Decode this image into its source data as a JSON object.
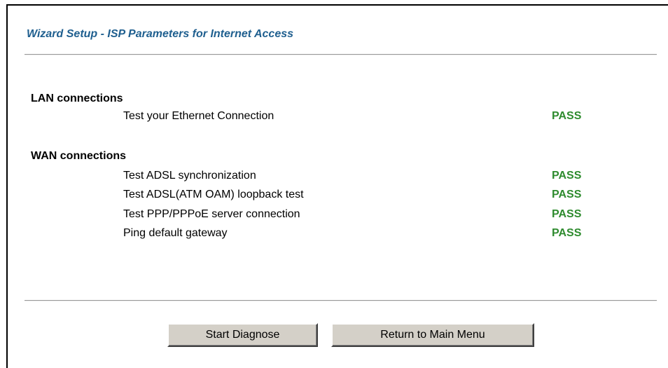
{
  "window": {
    "title": "Wizard Setup - ISP Parameters for Internet Access"
  },
  "sections": {
    "lan": {
      "heading": "LAN connections",
      "tests": [
        {
          "label": "Test your Ethernet Connection",
          "result": "PASS"
        }
      ]
    },
    "wan": {
      "heading": "WAN connections",
      "tests": [
        {
          "label": "Test ADSL synchronization",
          "result": "PASS"
        },
        {
          "label": "Test ADSL(ATM OAM) loopback test",
          "result": "PASS"
        },
        {
          "label": "Test PPP/PPPoE server connection",
          "result": "PASS"
        },
        {
          "label": "Ping default gateway",
          "result": "PASS"
        }
      ]
    }
  },
  "buttons": {
    "start_diagnose": "Start Diagnose",
    "return_main_menu": "Return to Main Menu"
  },
  "colors": {
    "title": "#1f5f8f",
    "pass": "#2e8b2e",
    "button_face": "#d4d0c8"
  }
}
